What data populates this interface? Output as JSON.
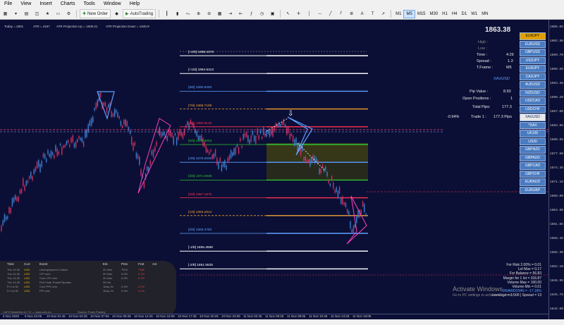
{
  "menu": [
    "File",
    "View",
    "Insert",
    "Charts",
    "Tools",
    "Window",
    "Help"
  ],
  "toolbar": {
    "new_order_label": "New Order",
    "auto_trading_label": "AutoTrading",
    "timeframes": [
      "M1",
      "M5",
      "M15",
      "M30",
      "H1",
      "H4",
      "D1",
      "W1",
      "MN"
    ],
    "active_timeframe": "M5"
  },
  "top_info": {
    "today": "Today = 2801",
    "atr": "ATR = 4157",
    "atr_up": "ATR Projection Up = 1905.01",
    "atr_down": "ATR Projection Down = 1840.9"
  },
  "levels": [
    {
      "label": "[+2/8]  1898.4375",
      "color": "#ffffff"
    },
    {
      "label": "[+1/8]  1894.5313",
      "color": "#ffffff"
    },
    {
      "label": "[8/8]  1890.6250",
      "color": "#5ea0ff"
    },
    {
      "label": "[7/8]  1886.7188",
      "color": "#f0a030"
    },
    {
      "label": "[6/8]  1882.8125",
      "color": "#ff3050"
    },
    {
      "label": "[5/8]  1878.9063",
      "color": "#30c030"
    },
    {
      "label": "[4/8]  1875.0000",
      "color": "#5ea0ff"
    },
    {
      "label": "[3/8]  1871.0938",
      "color": "#30c030"
    },
    {
      "label": "[2/8]  1867.1875",
      "color": "#ff3050"
    },
    {
      "label": "[1/8]  1863.2813",
      "color": "#f0a030"
    },
    {
      "label": "[0/8]  1859.3750",
      "color": "#5ea0ff"
    },
    {
      "label": "[-1/8]  1855.4688",
      "color": "#ffffff"
    },
    {
      "label": "[-2/8]  1851.5625",
      "color": "#ffffff"
    }
  ],
  "info_panel": {
    "price": "1863.38",
    "high_label": "High :",
    "low_label": "Low :",
    "time_label": "Time :",
    "time_value": "4:29",
    "spread_label": "Spread :",
    "spread_value": "1.3",
    "tframe_label": "T.Frame :",
    "tframe_value": "M5",
    "symbol": "XAUUSD",
    "pip_value_label": "Pip Value :",
    "pip_value": "8.50",
    "open_positions_label": "Open Positions :",
    "open_positions": "1",
    "total_pips_label": "Total Pips:",
    "total_pips": "177.3",
    "change": "-0.94%",
    "trade_label": "Trade 1 :",
    "trade_value": "177.3 Pips"
  },
  "pairs": [
    "EURJPY",
    "EURUSD",
    "GBPUSD",
    "USDJPY",
    "EURJPY",
    "CADJPY",
    "AUDUSD",
    "NZDUSD",
    "USDCAD",
    "USDCHF",
    "XAUUSD",
    "^DAX",
    "UK100",
    "US30",
    "GBPNZD",
    "GBPAUD",
    "GBPCAD",
    "GBPCHF",
    "EURAUD",
    "EURGBP"
  ],
  "price_ticks": [
    "1906.05",
    "1902.90",
    "1899.70",
    "1896.55",
    "1893.35",
    "1890.20",
    "1887.00",
    "1883.85",
    "1880.65",
    "1877.50",
    "1874.35",
    "1871.15",
    "1868.00",
    "1864.80",
    "1861.65",
    "1858.45",
    "1855.30",
    "1852.10",
    "1848.95",
    "1845.75",
    "1842.60"
  ],
  "time_ticks": [
    "9 Nov 2020",
    "9 Nov 22:05",
    "10 Nov 01:45",
    "10 Nov 04:25",
    "10 Nov 07:05",
    "10 Nov 09:45",
    "10 Nov 12:25",
    "10 Nov 15:05",
    "10 Nov 17:45",
    "10 Nov 20:25",
    "10 Nov 23:05",
    "11 Nov 02:45",
    "11 Nov 05:25",
    "11 Nov 08:05",
    "11 Nov 10:45",
    "11 Nov 13:25",
    "11 Nov 16:05"
  ],
  "news": {
    "headers": [
      "Time",
      "Curr.",
      "Event",
      "Est.",
      "Prev",
      "Fcst",
      "Act"
    ],
    "rows": [
      [
        "Thu 14:30",
        "USD",
        "Unemployment Claims",
        "2h 54m",
        "751K",
        "735K",
        ""
      ],
      [
        "Thu 14:30",
        "USD",
        "CPI m/m",
        "2h 54m",
        "0.2%",
        "0.1%",
        ""
      ],
      [
        "Thu 14:30",
        "USD",
        "Core CPI m/m",
        "2h 54m",
        "0.0%",
        "0.2%",
        ""
      ],
      [
        "Thu 14:35",
        "USD",
        "Fed Chair Powell Speaks",
        "3h 0m",
        "",
        "",
        ""
      ],
      [
        "Fri 14:30",
        "USD",
        "Core PPI m/m",
        "1Day 2h",
        "0.4%",
        "0.2%",
        ""
      ],
      [
        "Fri 14:30",
        "USD",
        "PPI m/m",
        "1Day 2h",
        "0.4%",
        "0.2%",
        ""
      ]
    ],
    "footer": "CoFX NewsInfo v2.7.0 — www.cofx.eu",
    "source": "Source: Forex Factory"
  },
  "risk": [
    "For Risk 2.00% = 0.01",
    "Lot Max = 0.17",
    "For Balance = 56.83",
    "Margin for 1 lot = 316.87",
    "Volume Max = 100.00",
    "Volume Min = 0.01",
    "DRAWDOWN = -17.18%",
    "Leverage = 1:500 | Spread = 13"
  ],
  "watermark": {
    "title": "Activate Windows",
    "subtitle": "Go to PC settings to activate Windows."
  }
}
